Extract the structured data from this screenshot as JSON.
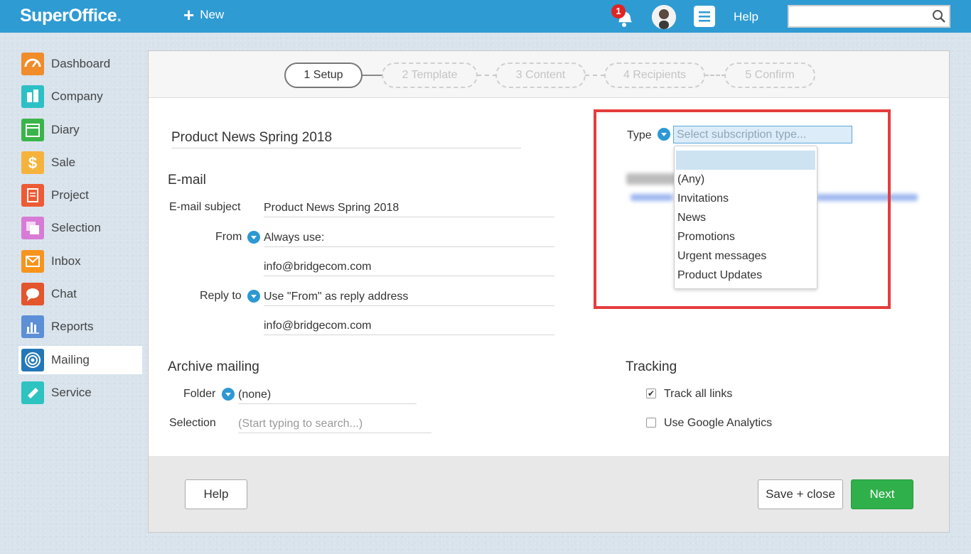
{
  "app": {
    "logo": "SuperOffice",
    "logo_dot": "."
  },
  "topbar": {
    "new_label": "New",
    "notification_count": "1",
    "help_label": "Help",
    "search_value": ""
  },
  "sidebar": {
    "items": [
      {
        "label": "Dashboard",
        "icon": "dashboard-icon",
        "color": "#f08c2a"
      },
      {
        "label": "Company",
        "icon": "company-icon",
        "color": "#2cc0c5"
      },
      {
        "label": "Diary",
        "icon": "diary-icon",
        "color": "#3ab54a"
      },
      {
        "label": "Sale",
        "icon": "sale-icon",
        "color": "#f6b33c"
      },
      {
        "label": "Project",
        "icon": "project-icon",
        "color": "#ec5b35"
      },
      {
        "label": "Selection",
        "icon": "selection-icon",
        "color": "#d87bd6"
      },
      {
        "label": "Inbox",
        "icon": "inbox-icon",
        "color": "#f7941d"
      },
      {
        "label": "Chat",
        "icon": "chat-icon",
        "color": "#e3552c"
      },
      {
        "label": "Reports",
        "icon": "reports-icon",
        "color": "#5c8fd6"
      },
      {
        "label": "Mailing",
        "icon": "mailing-icon",
        "color": "#2478b8",
        "active": true
      },
      {
        "label": "Service",
        "icon": "service-icon",
        "color": "#2dc3c0"
      }
    ]
  },
  "steps": [
    {
      "label": "1 Setup",
      "state": "done"
    },
    {
      "label": "2 Template",
      "state": "todo"
    },
    {
      "label": "3 Content",
      "state": "todo"
    },
    {
      "label": "4 Recipients",
      "state": "todo"
    },
    {
      "label": "5 Confirm",
      "state": "todo"
    }
  ],
  "form": {
    "name": "Product News Spring 2018",
    "email_section": "E-mail",
    "email_subject_label": "E-mail subject",
    "email_subject_value": "Product News Spring 2018",
    "from_label": "From",
    "from_option": "Always use:",
    "from_address": "info@bridgecom.com",
    "reply_label": "Reply to",
    "reply_option": "Use \"From\" as reply address",
    "reply_address": "info@bridgecom.com",
    "archive_section": "Archive mailing",
    "folder_label": "Folder",
    "folder_value": "(none)",
    "selection_label": "Selection",
    "selection_placeholder": "(Start typing to search...)",
    "type_label": "Type",
    "type_placeholder": "Select subscription type...",
    "type_options": [
      "",
      "(Any)",
      "Invitations",
      "News",
      "Promotions",
      "Urgent messages",
      "Product Updates"
    ],
    "tracking_section": "Tracking",
    "track_links_label": "Track all links",
    "track_links_checked": true,
    "analytics_label": "Use Google Analytics",
    "analytics_checked": false
  },
  "footer": {
    "help_label": "Help",
    "save_close_label": "Save + close",
    "next_label": "Next"
  },
  "colors": {
    "topbar": "#2f9bd3",
    "next_button": "#2fb04a",
    "highlight": "#e53c3c"
  }
}
